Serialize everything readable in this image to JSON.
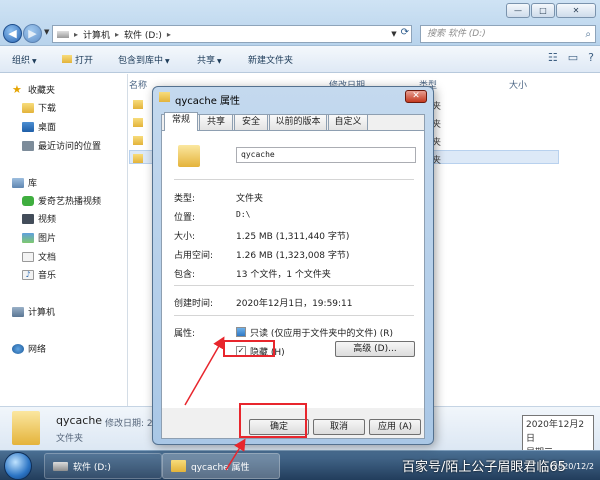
{
  "explorer": {
    "window_controls": {
      "min": "—",
      "max": "□",
      "close": "✕"
    },
    "address": {
      "computer": "计算机",
      "drive": "软件 (D:)",
      "refresh": "⟳"
    },
    "search_placeholder": "搜索 软件 (D:)",
    "toolbar": {
      "organize": "组织",
      "open": "打开",
      "include_library": "包含到库中",
      "share": "共享",
      "new_folder": "新建文件夹"
    },
    "nav": {
      "favorites": "收藏夹",
      "downloads": "下载",
      "desktop": "桌面",
      "recent": "最近访问的位置",
      "libraries": "库",
      "iqiyi": "爱奇艺热播视频",
      "videos": "视频",
      "pictures": "图片",
      "documents": "文档",
      "music": "音乐",
      "computer": "计算机",
      "network": "网络"
    },
    "columns": {
      "name": "名称",
      "modified": "修改日期",
      "type": "类型",
      "size": "大小"
    },
    "rows": [
      {
        "type": "夹"
      },
      {
        "type": "夹"
      },
      {
        "type": "夹"
      },
      {
        "type": "夹"
      }
    ],
    "details": {
      "name": "qycache",
      "meta": "修改日期: 20",
      "type": "文件夹"
    }
  },
  "dialog": {
    "title": "qycache 属性",
    "tabs": [
      "常规",
      "共享",
      "安全",
      "以前的版本",
      "自定义"
    ],
    "folder_name": "qycache",
    "props": [
      {
        "label": "类型:",
        "value": "文件夹"
      },
      {
        "label": "位置:",
        "value": "D:\\"
      },
      {
        "label": "大小:",
        "value": "1.25 MB (1,311,440 字节)"
      },
      {
        "label": "占用空间:",
        "value": "1.26 MB (1,323,008 字节)"
      },
      {
        "label": "包含:",
        "value": "13 个文件，1 个文件夹"
      }
    ],
    "created_label": "创建时间:",
    "created_value": "2020年12月1日，19:59:11",
    "attributes_label": "属性:",
    "readonly_label": "只读 (仅应用于文件夹中的文件) (R)",
    "hidden_label": "隐藏 (H)",
    "hidden_checked": true,
    "advanced_button": "高级 (D)...",
    "ok": "确定",
    "cancel": "取消",
    "apply": "应用 (A)"
  },
  "tooltip": {
    "date": "2020年12月2日",
    "weekday": "星期三"
  },
  "taskbar": {
    "items": [
      "软件 (D:)",
      "qycache 属性"
    ],
    "clock_time": "",
    "clock_date": "2020/12/2"
  },
  "watermark": "百家号/陌上公子眉眼君临65",
  "annotation_color": "#e8262d"
}
